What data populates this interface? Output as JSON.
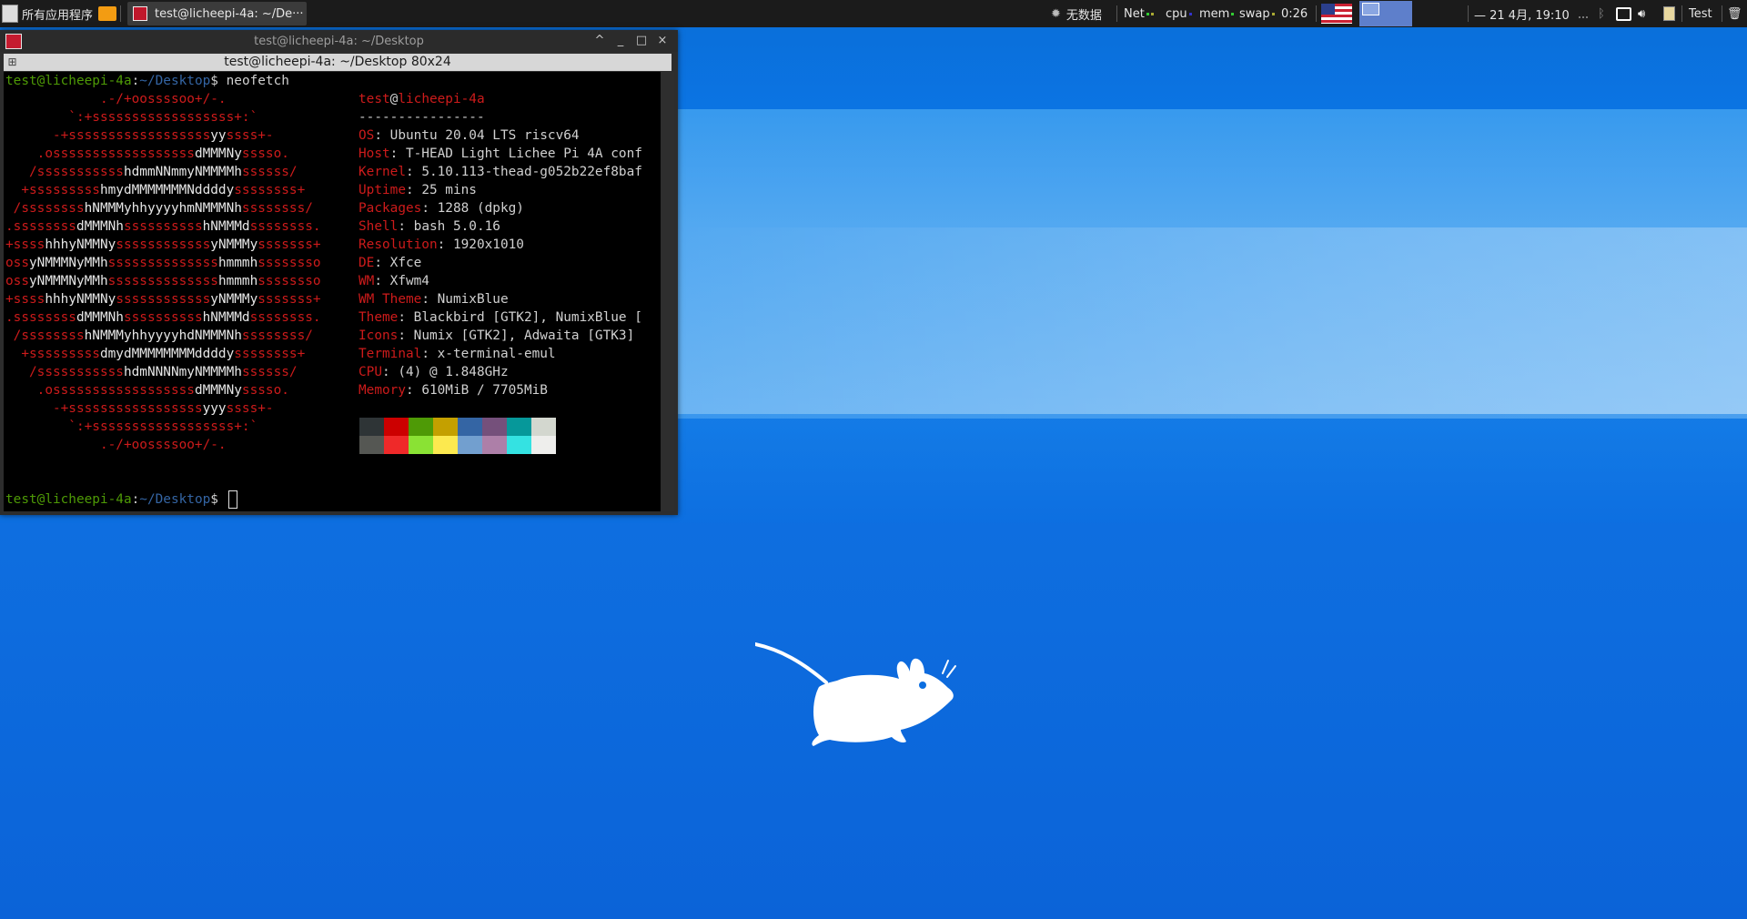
{
  "panel": {
    "apps_menu": "所有应用程序",
    "task_title": "test@licheepi-4a: ~/De···",
    "weather": "无数据",
    "net_label": "Net",
    "cpu_label": "cpu",
    "mem_label": "mem",
    "swap_label": "swap",
    "uptime": "0:26",
    "clock": "— 21 4月, 19:10",
    "user": "Test",
    "colors": {
      "bg": "#1b1b1b",
      "workspace_active": "#5e7fcb"
    }
  },
  "terminal": {
    "window_title": "test@licheepi-4a: ~/Desktop",
    "subtitle": "test@licheepi-4a: ~/Desktop 80x24",
    "prompt_user": "test@licheepi-4a",
    "prompt_path": "~/Desktop",
    "prompt_symbol": "$",
    "command": " neofetch",
    "info_user": "test",
    "info_at": "@",
    "info_host": "licheepi-4a",
    "info_sep": "----------------",
    "info": [
      {
        "k": "OS",
        "v": "Ubuntu 20.04 LTS riscv64"
      },
      {
        "k": "Host",
        "v": "T-HEAD Light Lichee Pi 4A conf"
      },
      {
        "k": "Kernel",
        "v": "5.10.113-thead-g052b22ef8baf"
      },
      {
        "k": "Uptime",
        "v": "25 mins"
      },
      {
        "k": "Packages",
        "v": "1288 (dpkg)"
      },
      {
        "k": "Shell",
        "v": "bash 5.0.16"
      },
      {
        "k": "Resolution",
        "v": "1920x1010"
      },
      {
        "k": "DE",
        "v": "Xfce"
      },
      {
        "k": "WM",
        "v": "Xfwm4"
      },
      {
        "k": "WM Theme",
        "v": "NumixBlue"
      },
      {
        "k": "Theme",
        "v": "Blackbird [GTK2], NumixBlue ["
      },
      {
        "k": "Icons",
        "v": "Numix [GTK2], Adwaita [GTK3]"
      },
      {
        "k": "Terminal",
        "v": "x-terminal-emul"
      },
      {
        "k": "CPU",
        "v": "(4) @ 1.848GHz"
      },
      {
        "k": "Memory",
        "v": "610MiB / 7705MiB"
      }
    ],
    "logo": [
      "            .-/+oossssoo+/-.",
      "        `:+ssssssssssssssssss+:`",
      "      -+ssssssssssssssssssyyssss+-",
      "    .ossssssssssssssssssdMMMNysssso.",
      "   /ssssssssssshdmmNNmmyNMMMMhssssss/",
      "  +ssssssssshmydMMMMMMMNddddyssssssss+",
      " /sssssssshNMMMyhhyyyyhmNMMMNhssssssss/",
      ".ssssssssdMMMNhsssssssssshNMMMdssssssss.",
      "+sssshhhyNMMNyssssssssssssyNMMMysssssss+",
      "ossyNMMMNyMMhsssssssssssssshmmmhssssssso",
      "ossyNMMMNyMMhsssssssssssssshmmmhssssssso",
      "+sssshhhyNMMNyssssssssssssyNMMMysssssss+",
      ".ssssssssdMMMNhsssssssssshNMMMdssssssss.",
      " /sssssssshNMMMyhhyyyyhdNMMMNhssssssss/",
      "  +sssssssssdmydMMMMMMMMddddyssssssss+",
      "   /ssssssssssshdmNNNNmyNMMMMhssssss/",
      "    .ossssssssssssssssssdMMMNysssso.",
      "      -+sssssssssssssssssyyyssss+-",
      "        `:+ssssssssssssssssss+:`",
      "            .-/+oossssoo+/-."
    ],
    "palette_top": [
      "#2e3436",
      "#cc0000",
      "#4e9a06",
      "#c4a000",
      "#3465a4",
      "#75507b",
      "#06989a",
      "#d3d7cf"
    ],
    "palette_bottom": [
      "#555753",
      "#ef2929",
      "#8ae234",
      "#fce94f",
      "#729fcf",
      "#ad7fa8",
      "#34e2e2",
      "#eeeeec"
    ]
  },
  "desktop": {
    "logo": "xfce-mouse",
    "colors": {
      "bg": "#0b6ee0"
    }
  }
}
